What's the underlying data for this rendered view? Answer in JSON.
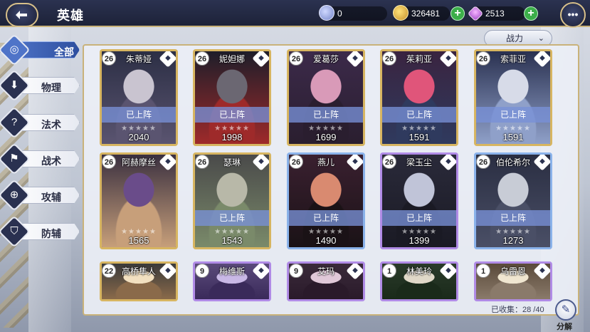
{
  "header": {
    "title": "英雄",
    "resource_a": "0",
    "resource_gold": "326481",
    "resource_gem": "2513"
  },
  "sort": {
    "label": "战力"
  },
  "tabs": [
    {
      "label": "全部",
      "icon": "ring-icon",
      "active": true
    },
    {
      "label": "物理",
      "icon": "sword-icon",
      "active": false
    },
    {
      "label": "法术",
      "icon": "magic-icon",
      "active": false
    },
    {
      "label": "战术",
      "icon": "tactic-icon",
      "active": false
    },
    {
      "label": "攻辅",
      "icon": "attack-support-icon",
      "active": false
    },
    {
      "label": "防辅",
      "icon": "shield-icon",
      "active": false
    }
  ],
  "heroes": [
    {
      "name": "朱蒂娅",
      "level": "26",
      "status": "已上阵",
      "power": "2040",
      "frame": "gold",
      "colors": [
        "#2c2f45",
        "#c9c4d0",
        "#5a5470"
      ]
    },
    {
      "name": "妮妲娜",
      "level": "26",
      "status": "已上阵",
      "power": "1998",
      "frame": "gold",
      "colors": [
        "#1e1e2a",
        "#6b6772",
        "#9e2a2a"
      ]
    },
    {
      "name": "爱葛莎",
      "level": "26",
      "status": "已上阵",
      "power": "1699",
      "frame": "gold",
      "colors": [
        "#3c2a4a",
        "#d99ab8",
        "#2a1e2f"
      ]
    },
    {
      "name": "茱莉亚",
      "level": "26",
      "status": "已上阵",
      "power": "1591",
      "frame": "gold",
      "colors": [
        "#3a2440",
        "#e0557a",
        "#2f3a5e"
      ]
    },
    {
      "name": "索菲亚",
      "level": "26",
      "status": "已上阵",
      "power": "1591",
      "frame": "gold",
      "colors": [
        "#2a3150",
        "#d7dbe8",
        "#8fa0c9"
      ]
    },
    {
      "name": "阿赫摩丝",
      "level": "26",
      "status": "",
      "power": "1565",
      "frame": "gold",
      "colors": [
        "#3a3040",
        "#6a4c8a",
        "#c79f7a"
      ]
    },
    {
      "name": "瑟琳",
      "level": "26",
      "status": "已上阵",
      "power": "1543",
      "frame": "gold",
      "colors": [
        "#4a4a4a",
        "#b8b8a8",
        "#7a8a6a"
      ]
    },
    {
      "name": "燕儿",
      "level": "26",
      "status": "已上阵",
      "power": "1490",
      "frame": "blue",
      "colors": [
        "#3a2030",
        "#d98a70",
        "#1a1216"
      ]
    },
    {
      "name": "梁玉尘",
      "level": "26",
      "status": "已上阵",
      "power": "1399",
      "frame": "purple",
      "colors": [
        "#2a2a3a",
        "#c0c4d8",
        "#1a1a24"
      ]
    },
    {
      "name": "伯伦希尔",
      "level": "26",
      "status": "已上阵",
      "power": "1273",
      "frame": "blue",
      "colors": [
        "#2a2e42",
        "#c8ccd6",
        "#4a4f66"
      ]
    },
    {
      "name": "高桥隼人",
      "level": "22",
      "status": "",
      "power": "",
      "frame": "gold",
      "colors": [
        "#3a3a3a",
        "#f2e0c0",
        "#8a6a4a"
      ]
    },
    {
      "name": "梅维斯",
      "level": "9",
      "status": "",
      "power": "",
      "frame": "purple",
      "colors": [
        "#5a4a7a",
        "#c9b8e6",
        "#3a2a5a"
      ]
    },
    {
      "name": "艾玛",
      "level": "9",
      "status": "",
      "power": "",
      "frame": "purple",
      "colors": [
        "#3a2a3a",
        "#e0c8d8",
        "#2a1a2a"
      ]
    },
    {
      "name": "林美玲",
      "level": "1",
      "status": "",
      "power": "",
      "frame": "purple",
      "colors": [
        "#2a3a2a",
        "#e0d8c8",
        "#1a2a1a"
      ]
    },
    {
      "name": "乌雷恩",
      "level": "1",
      "status": "",
      "power": "",
      "frame": "purple",
      "colors": [
        "#5a4a3a",
        "#f0e6d0",
        "#8a7a6a"
      ]
    }
  ],
  "footer": {
    "collected": "已收集：28 /40",
    "decompose_label": "分解"
  }
}
